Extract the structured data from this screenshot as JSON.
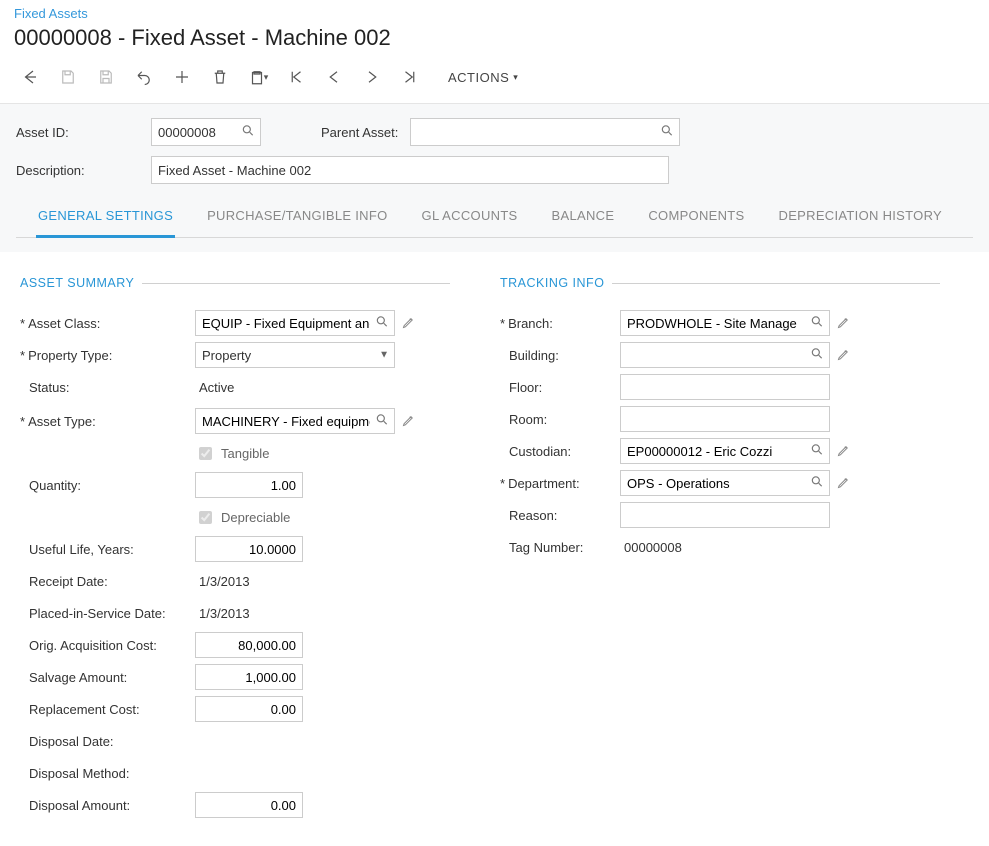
{
  "breadcrumb": "Fixed Assets",
  "title": "00000008 - Fixed Asset - Machine 002",
  "toolbar": {
    "actions": "ACTIONS"
  },
  "head_form": {
    "asset_id_label": "Asset ID:",
    "asset_id": "00000008",
    "parent_label": "Parent Asset:",
    "parent": "",
    "description_label": "Description:",
    "description": "Fixed Asset - Machine 002"
  },
  "tabs": {
    "general": "GENERAL SETTINGS",
    "purchase": "PURCHASE/TANGIBLE INFO",
    "gl": "GL ACCOUNTS",
    "balance": "BALANCE",
    "components": "COMPONENTS",
    "dep_hist": "DEPRECIATION HISTORY"
  },
  "sections": {
    "asset_summary": "ASSET SUMMARY",
    "tracking": "TRACKING INFO"
  },
  "summary": {
    "asset_class_label": "Asset Class:",
    "asset_class": "EQUIP - Fixed Equipment and",
    "property_type_label": "Property Type:",
    "property_type": "Property",
    "status_label": "Status:",
    "status": "Active",
    "asset_type_label": "Asset Type:",
    "asset_type": "MACHINERY - Fixed equipme",
    "tangible_label": "Tangible",
    "quantity_label": "Quantity:",
    "quantity": "1.00",
    "depreciable_label": "Depreciable",
    "useful_life_label": "Useful Life, Years:",
    "useful_life": "10.0000",
    "receipt_date_label": "Receipt Date:",
    "receipt_date": "1/3/2013",
    "placed_label": "Placed-in-Service Date:",
    "placed": "1/3/2013",
    "orig_cost_label": "Orig. Acquisition Cost:",
    "orig_cost": "80,000.00",
    "salvage_label": "Salvage Amount:",
    "salvage": "1,000.00",
    "replacement_label": "Replacement Cost:",
    "replacement": "0.00",
    "disposal_date_label": "Disposal Date:",
    "disposal_date": "",
    "disposal_method_label": "Disposal Method:",
    "disposal_method": "",
    "disposal_amount_label": "Disposal Amount:",
    "disposal_amount": "0.00"
  },
  "tracking": {
    "branch_label": "Branch:",
    "branch": "PRODWHOLE - Site Manage",
    "building_label": "Building:",
    "building": "",
    "floor_label": "Floor:",
    "floor": "",
    "room_label": "Room:",
    "room": "",
    "custodian_label": "Custodian:",
    "custodian": "EP00000012 - Eric Cozzi",
    "department_label": "Department:",
    "department": "OPS - Operations",
    "reason_label": "Reason:",
    "reason": "",
    "tag_label": "Tag Number:",
    "tag": "00000008"
  }
}
